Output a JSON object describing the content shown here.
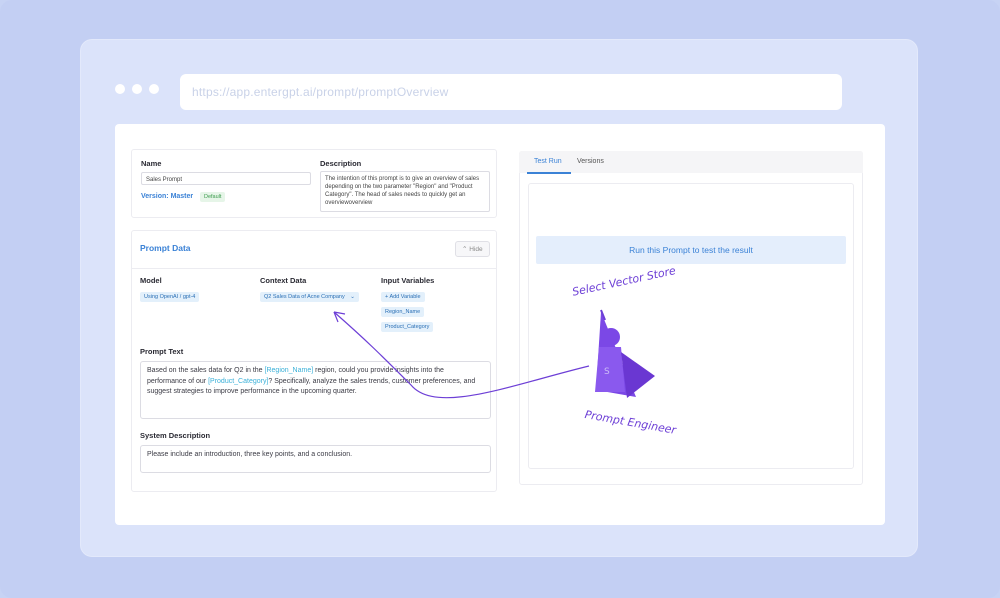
{
  "browser": {
    "url": "https://app.entergpt.ai/prompt/promptOverview"
  },
  "details": {
    "name_label": "Name",
    "name_value": "Sales Prompt",
    "version_label": "Version: Master",
    "version_badge": "Default",
    "description_label": "Description",
    "description_value": "The intention of this prompt is to give an overview of sales depending on the two parameter \"Region\" and \"Product Category\". The head of sales needs to quickly get an overviewoverview"
  },
  "prompt_data": {
    "title": "Prompt Data",
    "hide_label": "Hide",
    "model_label": "Model",
    "model_value": "Using OpenAI / gpt-4",
    "context_label": "Context Data",
    "context_value": "Q2 Sales Data of Acne Company",
    "input_vars_label": "Input Variables",
    "add_variable_label": "Add Variable",
    "variables": [
      "Region_Name",
      "Product_Category"
    ],
    "prompt_text_label": "Prompt Text",
    "prompt_text_1": "Based on the sales data for Q2 in the ",
    "prompt_var_1": "[Region_Name]",
    "prompt_text_2": " region, could you provide insights into the performance of our ",
    "prompt_var_2": "[Product_Category]",
    "prompt_text_3": "? Specifically, analyze the sales trends, customer preferences, and suggest strategies to improve performance in the upcoming quarter.",
    "system_desc_label": "System Description",
    "system_desc_value": "Please include an introduction, three key points, and a conclusion."
  },
  "right_panel": {
    "tabs": [
      "Test Run",
      "Versions"
    ],
    "run_button": "Run this Prompt to test the result"
  },
  "annotations": {
    "top": "Select Vector Store",
    "bottom": "Prompt Engineer"
  },
  "colors": {
    "accent": "#3b82d6",
    "annotation": "#6d3fd6",
    "background": "#c7d3f4"
  }
}
